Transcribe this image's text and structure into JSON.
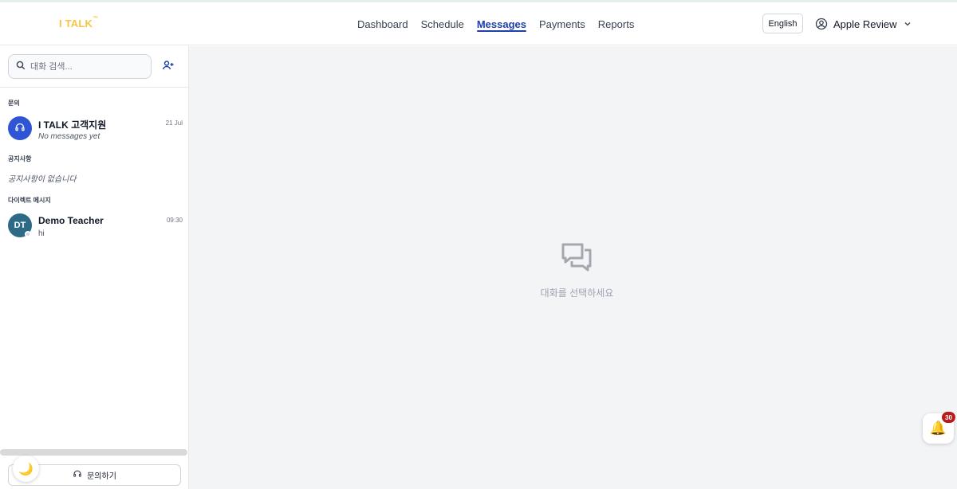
{
  "app": {
    "logo": "I TALK",
    "logo_mark": "™"
  },
  "nav": {
    "items": [
      {
        "label": "Dashboard"
      },
      {
        "label": "Schedule"
      },
      {
        "label": "Messages",
        "active": true
      },
      {
        "label": "Payments"
      },
      {
        "label": "Reports"
      }
    ]
  },
  "header": {
    "language": "English",
    "user_name": "Apple Review"
  },
  "sidebar": {
    "search_placeholder": "대화 검색...",
    "sections": {
      "inquiry": "문의",
      "notices": "공지사항",
      "direct": "다이렉트 메시지"
    },
    "conversations": {
      "support": {
        "name": "I TALK 고객지원",
        "time": "21 Jul",
        "preview": "No messages yet"
      },
      "teacher": {
        "initials": "DT",
        "name": "Demo Teacher",
        "time": "09:30",
        "preview": "hi"
      }
    },
    "no_notices": "공지사항이 없습니다",
    "inquiry_button": "문의하기"
  },
  "main": {
    "empty_text": "대화를 선택하세요"
  },
  "notifications": {
    "count": "30"
  },
  "colors": {
    "brand": "#f5c542",
    "accent": "#1e40af",
    "support_avatar": "#2f55d4",
    "teacher_avatar": "#2d6a87",
    "badge": "#b91c1c"
  },
  "icons": {
    "search": "search-icon",
    "add_user": "user-plus-icon",
    "user": "user-circle-icon",
    "chevron": "chevron-down-icon",
    "headset": "headset-icon",
    "chat": "chat-bubbles-icon",
    "moon": "moon-icon",
    "bell": "bell-icon"
  }
}
